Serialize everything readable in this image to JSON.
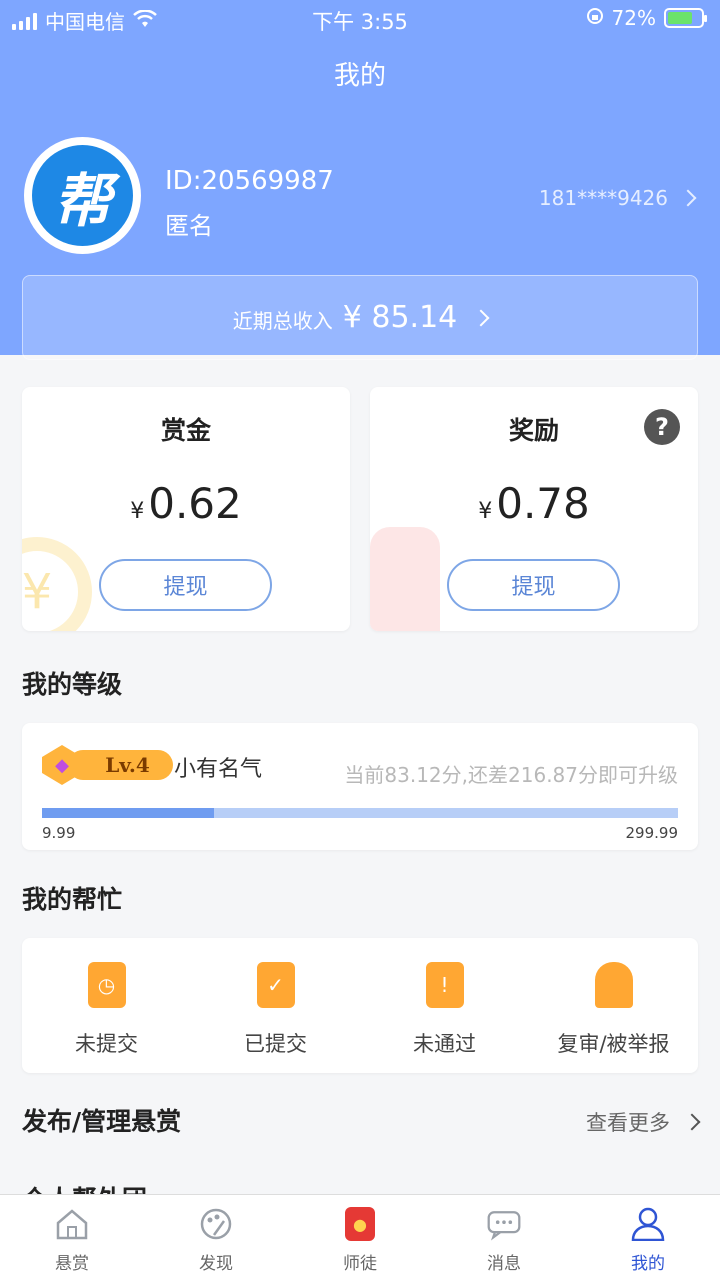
{
  "status_bar": {
    "carrier": "中国电信",
    "time": "下午 3:55",
    "battery": "72%"
  },
  "header": {
    "title": "我的"
  },
  "profile": {
    "id": "ID:20569987",
    "name": "匿名",
    "phone": "181****9426",
    "avatar_glyph": "帮"
  },
  "income": {
    "label": "近期总收入",
    "amount": "¥ 85.14"
  },
  "bounty_card": {
    "title": "赏金",
    "currency": "¥",
    "amount": "0.62",
    "button": "提现"
  },
  "reward_card": {
    "title": "奖励",
    "currency": "¥",
    "amount": "0.78",
    "button": "提现",
    "help": "?"
  },
  "level": {
    "section_title": "我的等级",
    "badge": "Lv.4",
    "name": "小有名气",
    "tip": "当前83.12分,还差216.87分即可升级",
    "min": "9.99",
    "max": "299.99",
    "progress": 0.27
  },
  "my_help": {
    "section_title": "我的帮忙",
    "items": [
      {
        "label": "未提交",
        "icon": "clock-doc-icon"
      },
      {
        "label": "已提交",
        "icon": "check-doc-icon"
      },
      {
        "label": "未通过",
        "icon": "warning-doc-icon"
      },
      {
        "label": "复审/被举报",
        "icon": "alarm-icon"
      }
    ]
  },
  "publish": {
    "title": "发布/管理悬赏",
    "more": "查看更多"
  },
  "peek_title": "个人帮外团",
  "tabs": [
    {
      "label": "悬赏",
      "icon": "home-icon"
    },
    {
      "label": "发现",
      "icon": "palette-icon"
    },
    {
      "label": "师徒",
      "icon": "redpacket-icon"
    },
    {
      "label": "消息",
      "icon": "chat-icon"
    },
    {
      "label": "我的",
      "icon": "user-icon"
    }
  ],
  "colors": {
    "header": "#7ea6ff",
    "accent": "#2f55d4",
    "orange": "#ffa733"
  }
}
